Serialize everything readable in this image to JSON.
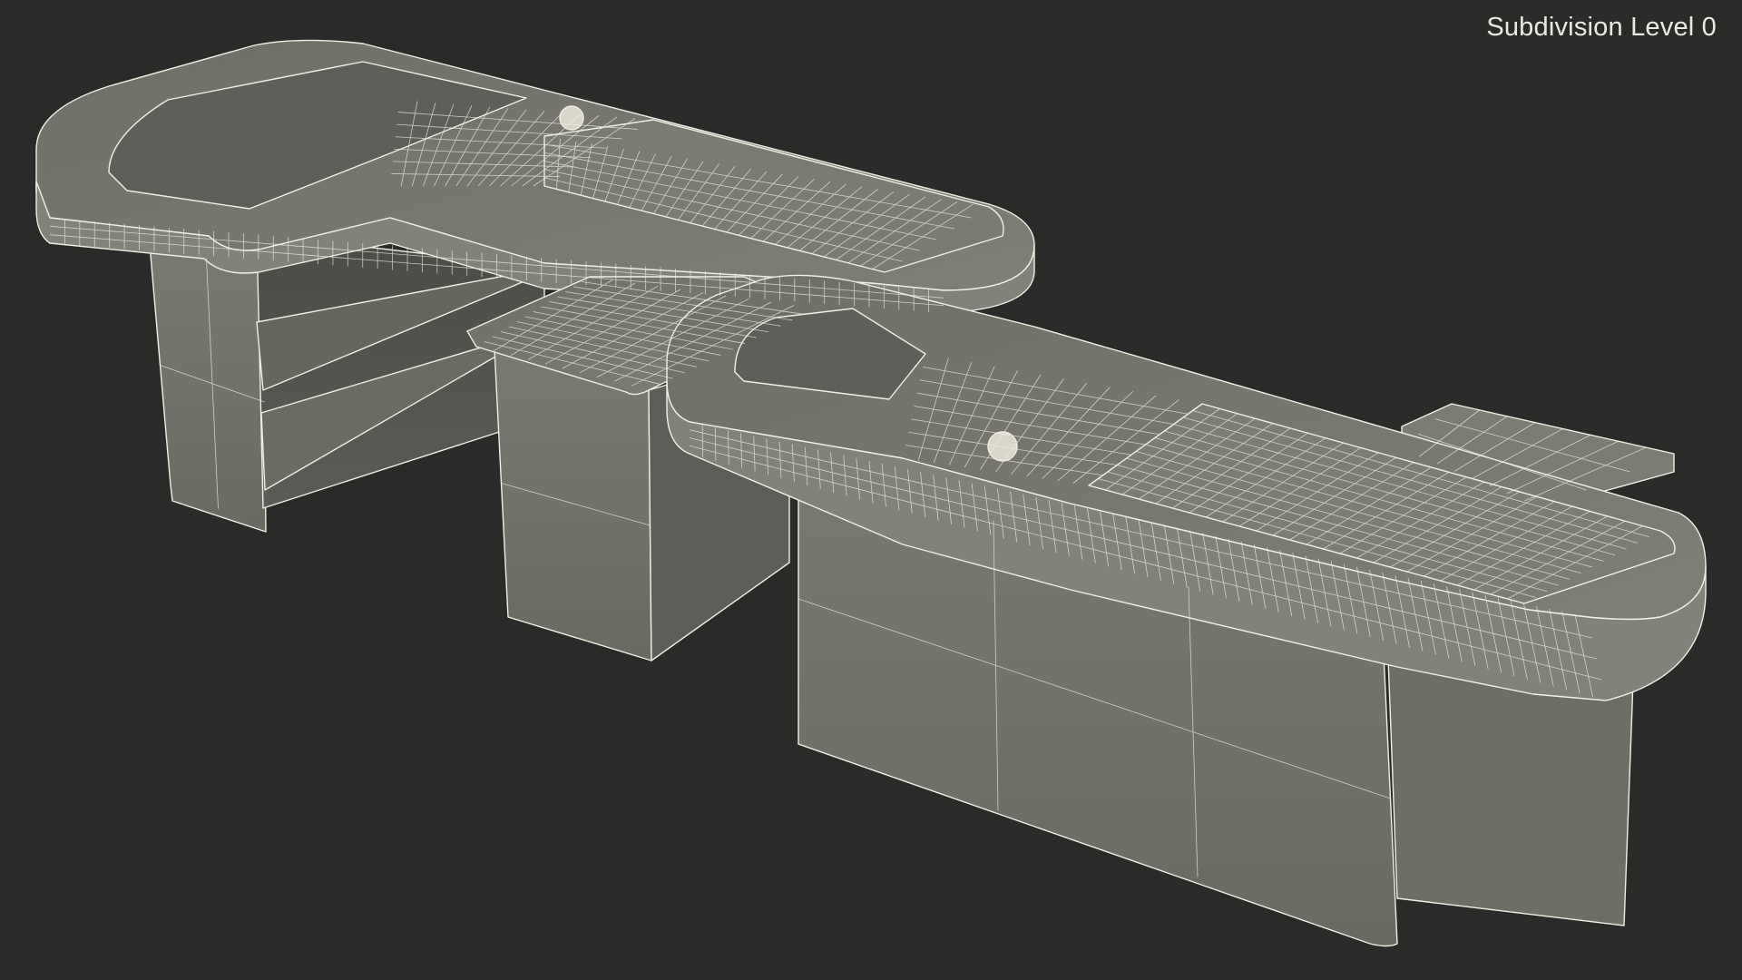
{
  "viewport": {
    "overlay_label": "Subdivision Level 0",
    "background_color": "#2a2a28",
    "surface_color": "#777770",
    "wire_color": "#f0efe6"
  },
  "scene": {
    "subject": "supermarket checkout counters wireframe",
    "objects": [
      "rear-checkout-counter",
      "bagging-shelf-cabinet",
      "middle-cabinet",
      "front-checkout-counter",
      "front-cash-tray"
    ]
  }
}
